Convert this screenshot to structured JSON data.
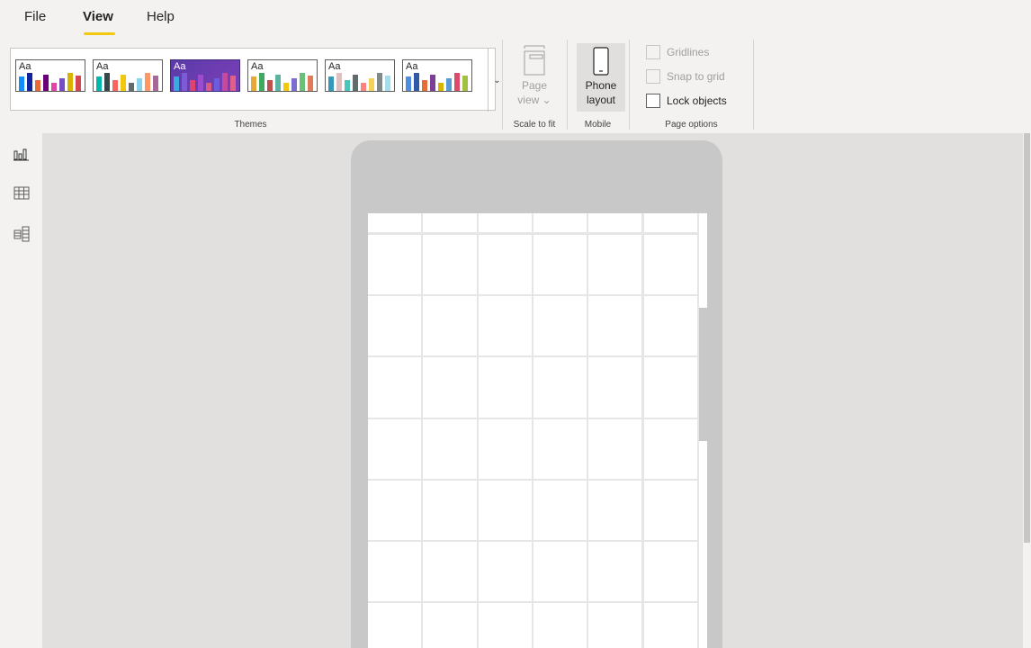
{
  "menu": {
    "tabs": [
      {
        "label": "File",
        "active": false
      },
      {
        "label": "View",
        "active": true
      },
      {
        "label": "Help",
        "active": false
      }
    ],
    "accent_color": "#f2c811"
  },
  "ribbon": {
    "themes": {
      "group_label": "Themes",
      "swatch_label": "Aa",
      "swatches": [
        {
          "style": "light",
          "colors": [
            "#118dff",
            "#12239e",
            "#e66c37",
            "#6b007b",
            "#e044a7",
            "#744ec2",
            "#d9b300",
            "#d64550"
          ]
        },
        {
          "style": "light",
          "colors": [
            "#01b8aa",
            "#374649",
            "#fd625e",
            "#f2c80f",
            "#5f6b6d",
            "#8ad4eb",
            "#fe9666",
            "#a66999"
          ]
        },
        {
          "style": "dark",
          "colors": [
            "#3ba8e0",
            "#7b5bd6",
            "#e0446e",
            "#a04ad0",
            "#d95b84",
            "#6b5ce0",
            "#c44aa0",
            "#e0608a"
          ]
        },
        {
          "style": "light",
          "colors": [
            "#e8a838",
            "#41a85f",
            "#c0504d",
            "#5bb3a1",
            "#f2c80f",
            "#7a6fd0",
            "#69c078",
            "#e07b5b"
          ]
        },
        {
          "style": "light",
          "colors": [
            "#3599b8",
            "#dfbfbf",
            "#4ac5bb",
            "#5f6b6d",
            "#fb8281",
            "#f4d25a",
            "#7f898a",
            "#a4ddee"
          ]
        },
        {
          "style": "light",
          "colors": [
            "#4e8de0",
            "#2f5aa8",
            "#e66c37",
            "#7b3f98",
            "#d9b300",
            "#5b9bd5",
            "#e04a6a",
            "#a0c040"
          ]
        }
      ],
      "more_label": "⌄"
    },
    "scale_to_fit": {
      "group_label": "Scale to fit",
      "page_view": {
        "line1": "Page",
        "line2": "view ⌄",
        "enabled": false
      }
    },
    "mobile": {
      "group_label": "Mobile",
      "phone_layout": {
        "line1": "Phone",
        "line2": "layout",
        "selected": true
      }
    },
    "page_options": {
      "group_label": "Page options",
      "gridlines": {
        "label": "Gridlines",
        "enabled": false,
        "checked": false
      },
      "snap_to_grid": {
        "label": "Snap to grid",
        "enabled": false,
        "checked": false
      },
      "lock_objects": {
        "label": "Lock objects",
        "enabled": true,
        "checked": false
      }
    }
  },
  "left_rail": {
    "items": [
      {
        "icon": "report-icon"
      },
      {
        "icon": "data-table-icon"
      },
      {
        "icon": "model-icon"
      }
    ]
  },
  "canvas": {
    "grid_columns": 6,
    "grid_rows": 8,
    "phone_frame_color": "#c8c8c8",
    "grid_cell_color": "#ffffff",
    "grid_line_color": "#e6e6e6"
  }
}
